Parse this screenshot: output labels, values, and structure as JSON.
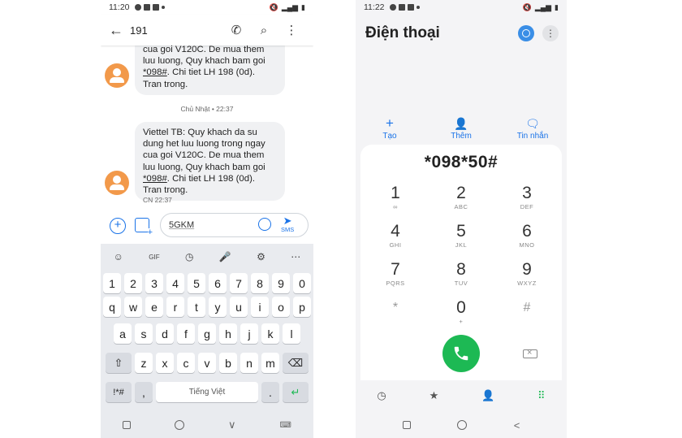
{
  "left": {
    "status": {
      "time": "11:20"
    },
    "appbar": {
      "back": "←",
      "title": "191",
      "call": "✆",
      "search": "⌕",
      "more": "⋮"
    },
    "msg1": {
      "l1": "cua goi V120C. De mua them",
      "l2": "luu luong, Quy khach bam goi",
      "code": "*098#",
      "l3tail": ". Chi tiet LH 198 (0d).",
      "l4": "Tran trong."
    },
    "date_separator": "Chủ Nhật • 22:37",
    "msg2": {
      "l1": "Viettel TB: Quy khach da su",
      "l2": "dung het luu luong trong ngay",
      "l3": "cua goi V120C. De mua them",
      "l4": "luu luong, Quy khach bam goi",
      "code": "*098#",
      "l5tail": ". Chi tiet LH 198 (0d).",
      "l6": "Tran trong.",
      "meta": "CN 22:37"
    },
    "compose": {
      "add": "+",
      "value": "5GKM",
      "send_label": "SMS"
    },
    "keyboard": {
      "toolbar": [
        "☺",
        "GIF",
        "◷",
        "🎤",
        "⚙",
        "⋯"
      ],
      "row1": [
        "1",
        "2",
        "3",
        "4",
        "5",
        "6",
        "7",
        "8",
        "9",
        "0"
      ],
      "row2": [
        "q",
        "w",
        "e",
        "r",
        "t",
        "y",
        "u",
        "i",
        "o",
        "p"
      ],
      "row3": [
        "a",
        "s",
        "d",
        "f",
        "g",
        "h",
        "j",
        "k",
        "l"
      ],
      "row4": [
        "⇧",
        "z",
        "x",
        "c",
        "v",
        "b",
        "n",
        "m",
        "⌫"
      ],
      "symbols": "!*#",
      "comma": ",",
      "space": "Tiếng Việt",
      "period": ".",
      "enter": "↵"
    },
    "nav": {
      "back": "∨",
      "kbd": "⌨"
    }
  },
  "right": {
    "status": {
      "time": "11:22"
    },
    "title": "Điện thoại",
    "more": "⋮",
    "actions": [
      {
        "icon": "+",
        "label": "Tạo"
      },
      {
        "icon": "👤",
        "label": "Thêm"
      },
      {
        "icon": "🗨",
        "label": "Tin nhắn"
      }
    ],
    "number": "*098*50#",
    "keys": [
      {
        "digit": "1",
        "letters": "∞"
      },
      {
        "digit": "2",
        "letters": "ABC"
      },
      {
        "digit": "3",
        "letters": "DEF"
      },
      {
        "digit": "4",
        "letters": "GHI"
      },
      {
        "digit": "5",
        "letters": "JKL"
      },
      {
        "digit": "6",
        "letters": "MNO"
      },
      {
        "digit": "7",
        "letters": "PQRS"
      },
      {
        "digit": "8",
        "letters": "TUV"
      },
      {
        "digit": "9",
        "letters": "WXYZ"
      },
      {
        "digit": "*",
        "letters": ""
      },
      {
        "digit": "0",
        "letters": "+"
      },
      {
        "digit": "#",
        "letters": ""
      }
    ],
    "tabs": [
      "◷",
      "★",
      "👤",
      "⠿"
    ],
    "nav": {
      "back": "<"
    },
    "colors": {
      "accent": "#1a73e8",
      "call": "#1db954"
    }
  }
}
